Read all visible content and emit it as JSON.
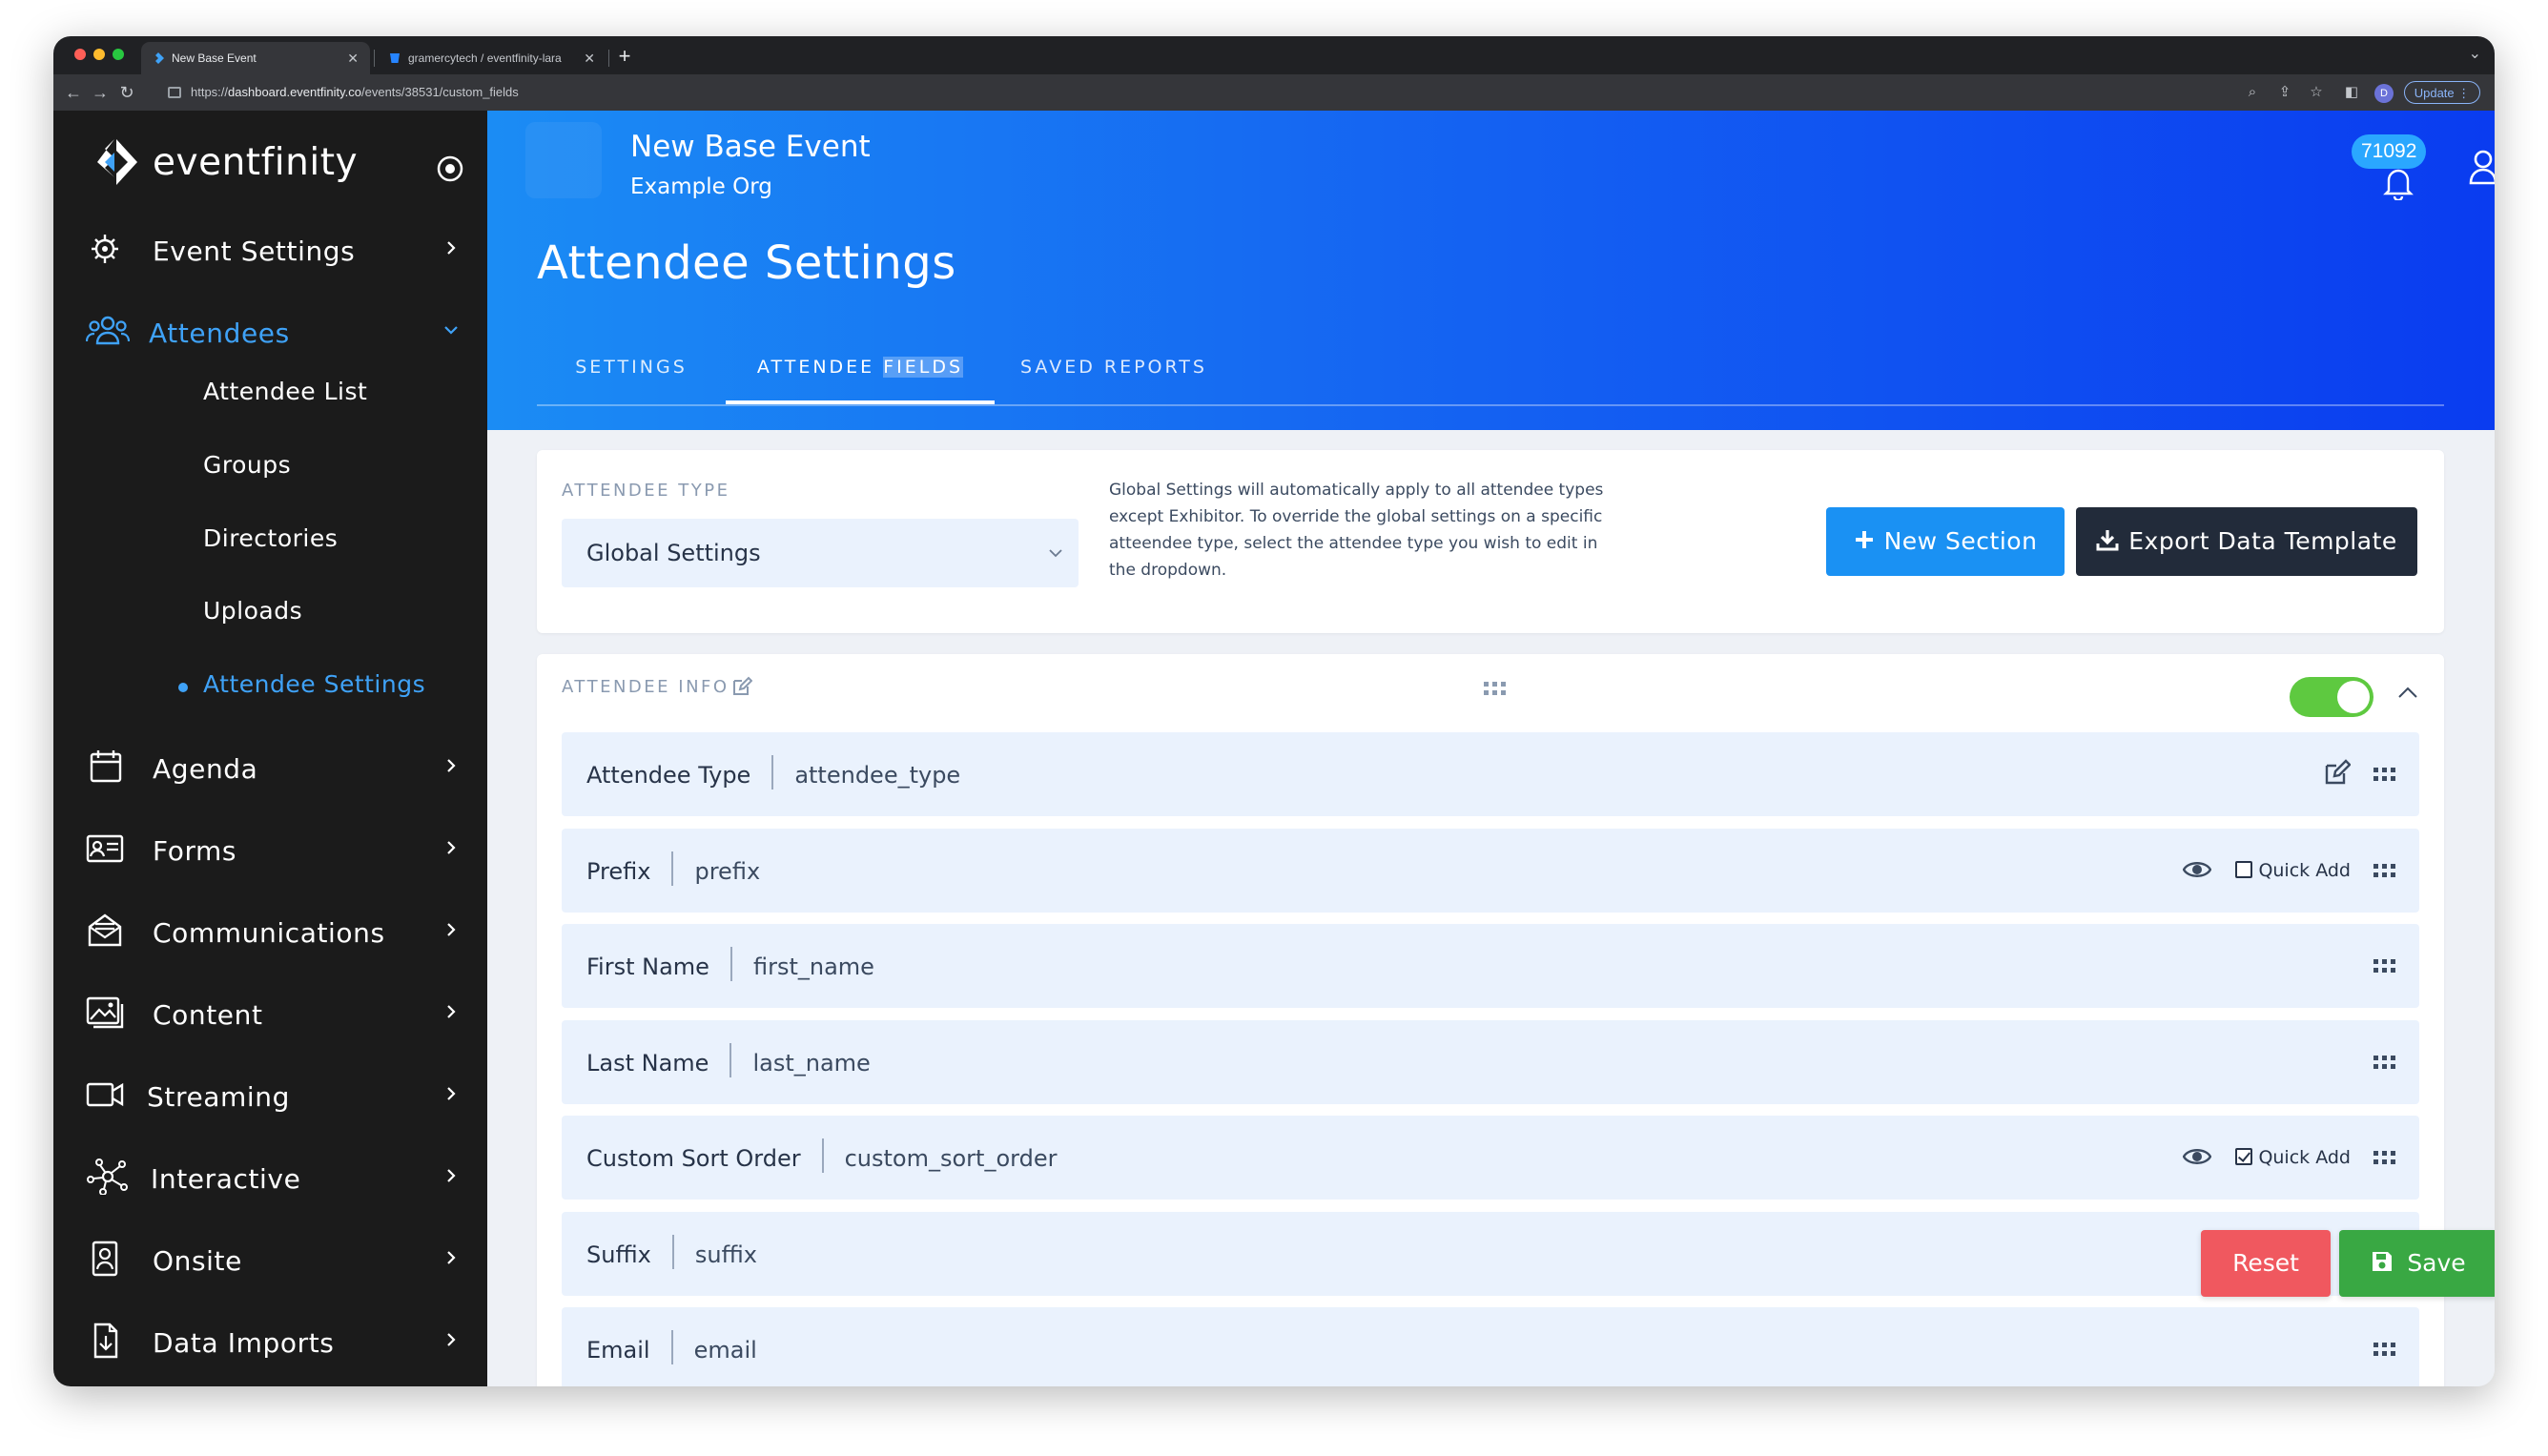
{
  "browser": {
    "tabs": [
      {
        "title": "New Base Event",
        "active": true
      },
      {
        "title": "gramercytech / eventfinity-lara",
        "active": false
      }
    ],
    "url_prefix": "https://",
    "url_host": "dashboard.eventfinity.co",
    "url_path": "/events/38531/custom_fields",
    "profile_initial": "D",
    "update_label": "Update"
  },
  "sidebar": {
    "brand": "eventfinity",
    "items": [
      {
        "label": "Event Settings",
        "icon": "gear-users-icon"
      },
      {
        "label": "Attendees",
        "icon": "users-icon",
        "open": true
      },
      {
        "label": "Agenda",
        "icon": "calendar-icon"
      },
      {
        "label": "Forms",
        "icon": "id-card-icon"
      },
      {
        "label": "Communications",
        "icon": "envelope-icon"
      },
      {
        "label": "Content",
        "icon": "images-icon"
      },
      {
        "label": "Streaming",
        "icon": "video-icon"
      },
      {
        "label": "Interactive",
        "icon": "network-icon"
      },
      {
        "label": "Onsite",
        "icon": "badge-icon"
      },
      {
        "label": "Data Imports",
        "icon": "file-import-icon"
      }
    ],
    "subitems": [
      {
        "label": "Attendee List"
      },
      {
        "label": "Groups"
      },
      {
        "label": "Directories"
      },
      {
        "label": "Uploads"
      },
      {
        "label": "Attendee Settings",
        "active": true
      }
    ]
  },
  "header": {
    "event_name": "New Base Event",
    "org_name": "Example Org",
    "page_title": "Attendee Settings",
    "notification_count": "71092",
    "tabs": [
      {
        "label": "SETTINGS"
      },
      {
        "label_pre": "ATTENDEE ",
        "label_hl": "FIELDS",
        "active": true
      },
      {
        "label": "SAVED REPORTS"
      }
    ]
  },
  "type_card": {
    "label": "ATTENDEE TYPE",
    "selected": "Global Settings",
    "help": "Global Settings will automatically apply to all attendee types except Exhibitor. To override the global settings on a specific atteendee type, select the attendee type you wish to edit in the dropdown.",
    "new_section_label": "New Section",
    "export_label": "Export Data Template"
  },
  "section": {
    "title": "ATTENDEE INFO",
    "enabled": true,
    "fields": [
      {
        "name": "Attendee Type",
        "key": "attendee_type",
        "editable": true
      },
      {
        "name": "Prefix",
        "key": "prefix",
        "visible_toggle": true,
        "quick_add": false,
        "quick_add_label": "Quick Add"
      },
      {
        "name": "First Name",
        "key": "first_name"
      },
      {
        "name": "Last Name",
        "key": "last_name"
      },
      {
        "name": "Custom Sort Order",
        "key": "custom_sort_order",
        "visible_toggle": true,
        "quick_add": true,
        "quick_add_label": "Quick Add"
      },
      {
        "name": "Suffix",
        "key": "suffix"
      },
      {
        "name": "Email",
        "key": "email"
      }
    ]
  },
  "actions": {
    "reset_label": "Reset",
    "save_label": "Save"
  },
  "colors": {
    "accent": "#1a91f3",
    "sidebar_bg": "#1b1b1b",
    "sidebar_active": "#3fa2f7",
    "toggle_on": "#5ec940",
    "reset": "#f0585f",
    "save": "#39a843",
    "row_bg": "#eaf2fd"
  }
}
